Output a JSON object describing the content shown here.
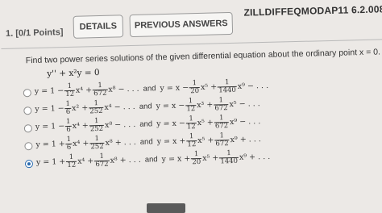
{
  "header": {
    "question_number": "1. [0/1 Points]",
    "details_label": "DETAILS",
    "previous_answers_label": "PREVIOUS ANSWERS",
    "course_code": "ZILLDIFFEQMODAP11 6.2.008."
  },
  "question": {
    "prompt": "Find two power series solutions of the given differential equation about the ordinary point x = 0.",
    "equation": "y'' + x²y = 0"
  },
  "options": [
    {
      "selected": false,
      "first": {
        "lead": "y = 1 −",
        "t1": {
          "n": "1",
          "d": "12"
        },
        "p1": "x⁴ +",
        "t2": {
          "n": "1",
          "d": "672"
        },
        "p2": "x⁸ − . . ."
      },
      "and": "and",
      "second": {
        "lead": "y = x −",
        "t1": {
          "n": "1",
          "d": "20"
        },
        "p1": "x⁵ +",
        "t2": {
          "n": "1",
          "d": "1440"
        },
        "p2": "x⁹ − . . ."
      }
    },
    {
      "selected": false,
      "first": {
        "lead": "y = 1 −",
        "t1": {
          "n": "1",
          "d": "6"
        },
        "p1": "x² +",
        "t2": {
          "n": "1",
          "d": "252"
        },
        "p2": "x⁴ − . . ."
      },
      "and": "and",
      "second": {
        "lead": "y = x −",
        "t1": {
          "n": "1",
          "d": "12"
        },
        "p1": "x³ +",
        "t2": {
          "n": "1",
          "d": "672"
        },
        "p2": "x⁵ − . . ."
      }
    },
    {
      "selected": false,
      "first": {
        "lead": "y = 1 −",
        "t1": {
          "n": "1",
          "d": "6"
        },
        "p1": "x⁴ +",
        "t2": {
          "n": "1",
          "d": "252"
        },
        "p2": "x⁸ − . . ."
      },
      "and": "and",
      "second": {
        "lead": "y = x −",
        "t1": {
          "n": "1",
          "d": "12"
        },
        "p1": "x⁵ +",
        "t2": {
          "n": "1",
          "d": "672"
        },
        "p2": "x⁹ − . . ."
      }
    },
    {
      "selected": false,
      "first": {
        "lead": "y = 1 +",
        "t1": {
          "n": "1",
          "d": "6"
        },
        "p1": "x⁴ +",
        "t2": {
          "n": "1",
          "d": "252"
        },
        "p2": "x⁸ + . . ."
      },
      "and": "and",
      "second": {
        "lead": "y = x +",
        "t1": {
          "n": "1",
          "d": "12"
        },
        "p1": "x⁵ +",
        "t2": {
          "n": "1",
          "d": "672"
        },
        "p2": "x⁹ + . . ."
      }
    },
    {
      "selected": true,
      "first": {
        "lead": "y = 1 +",
        "t1": {
          "n": "1",
          "d": "12"
        },
        "p1": "x⁴ +",
        "t2": {
          "n": "1",
          "d": "672"
        },
        "p2": "x⁸ + . . ."
      },
      "and": "and",
      "second": {
        "lead": "y = x +",
        "t1": {
          "n": "1",
          "d": "20"
        },
        "p1": "x⁵ +",
        "t2": {
          "n": "1",
          "d": "1440"
        },
        "p2": "x⁹ + . . ."
      }
    }
  ],
  "colors": {
    "accent": "#2b6cb0",
    "background": "#ece9e6"
  }
}
